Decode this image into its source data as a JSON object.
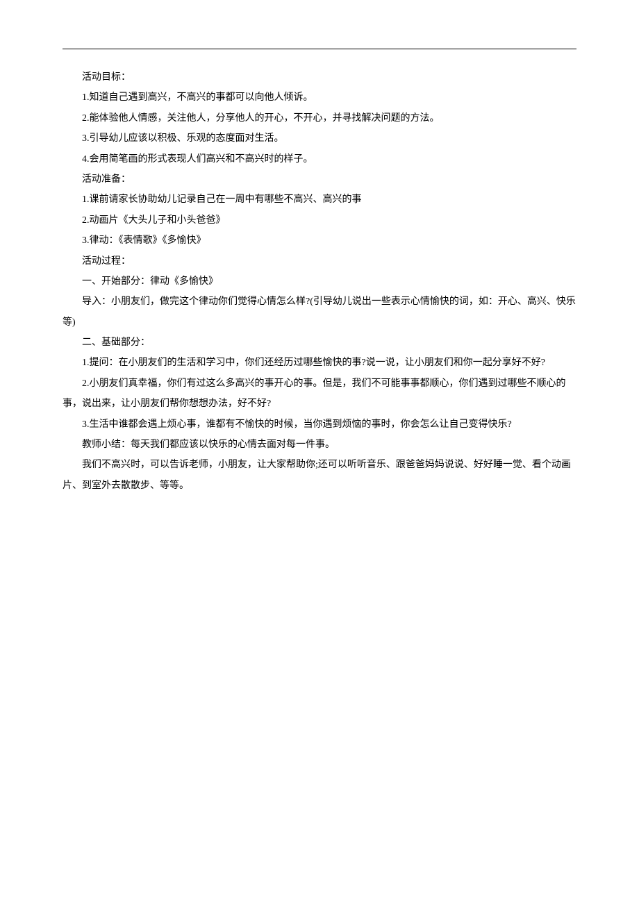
{
  "sections": {
    "goals_header": "活动目标：",
    "goals": [
      "1.知道自己遇到高兴，不高兴的事都可以向他人倾诉。",
      "2.能体验他人情感，关注他人，分享他人的开心，不开心，并寻找解决问题的方法。",
      "3.引导幼儿应该以积极、乐观的态度面对生活。",
      "4.会用简笔画的形式表现人们高兴和不高兴时的样子。"
    ],
    "prep_header": "活动准备：",
    "prep": [
      "1.课前请家长协助幼儿记录自己在一周中有哪些不高兴、高兴的事",
      "2.动画片《大头儿子和小头爸爸》",
      "3.律动：《表情歌》《多愉快》"
    ],
    "process_header": "活动过程：",
    "start_header": "一、开始部分：律动《多愉快》",
    "start_intro": "导入：小朋友们，做完这个律动你们觉得心情怎么样?(引导幼儿说出一些表示心情愉快的词，如：开心、高兴、快乐等)",
    "base_header": "二、基础部分：",
    "base_q1": "1.提问：在小朋友们的生活和学习中，你们还经历过哪些愉快的事?说一说，让小朋友们和你一起分享好不好?",
    "base_q2": "2.小朋友们真幸福，你们有过这么多高兴的事开心的事。但是，我们不可能事事都顺心，你们遇到过哪些不顺心的事，说出来，让小朋友们帮你想想办法，好不好?",
    "base_q3": "3.生活中谁都会遇上烦心事，谁都有不愉快的时候，当你遇到烦恼的事时，你会怎么让自己变得快乐?",
    "summary_label": "教师小结：每天我们都应该以快乐的心情去面对每一件事。",
    "summary_text": "我们不高兴时，可以告诉老师，小朋友，让大家帮助你;还可以听听音乐、跟爸爸妈妈说说、好好睡一觉、看个动画片、到室外去散散步、等等。"
  }
}
